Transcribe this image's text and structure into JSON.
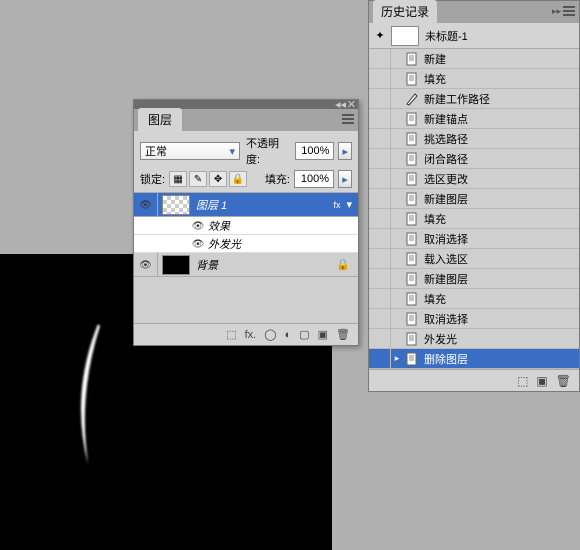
{
  "layers_panel": {
    "title": "图层",
    "blend_mode": "正常",
    "opacity_label": "不透明度:",
    "opacity_value": "100%",
    "lock_label": "锁定:",
    "fill_label": "填充:",
    "fill_value": "100%",
    "layers": [
      {
        "name": "图层 1",
        "fx": "fx",
        "selected": true,
        "thumb": "checker"
      },
      {
        "name": "效果",
        "sub": true
      },
      {
        "name": "外发光",
        "sub": true
      },
      {
        "name": "背景",
        "lock": true,
        "thumb": "black"
      }
    ],
    "footer_icons": [
      "link",
      "fx.",
      "mask",
      "adj",
      "group",
      "new",
      "trash"
    ]
  },
  "history_panel": {
    "title": "历史记录",
    "snapshot": "未标题-1",
    "items": [
      {
        "icon": "doc",
        "text": "新建"
      },
      {
        "icon": "doc",
        "text": "填充"
      },
      {
        "icon": "pen",
        "text": "新建工作路径"
      },
      {
        "icon": "doc",
        "text": "新建锚点"
      },
      {
        "icon": "doc",
        "text": "挑选路径"
      },
      {
        "icon": "doc",
        "text": "闭合路径"
      },
      {
        "icon": "doc",
        "text": "选区更改"
      },
      {
        "icon": "doc",
        "text": "新建图层"
      },
      {
        "icon": "doc",
        "text": "填充"
      },
      {
        "icon": "doc",
        "text": "取消选择"
      },
      {
        "icon": "doc",
        "text": "载入选区"
      },
      {
        "icon": "doc",
        "text": "新建图层"
      },
      {
        "icon": "doc",
        "text": "填充"
      },
      {
        "icon": "doc",
        "text": "取消选择"
      },
      {
        "icon": "doc",
        "text": "外发光"
      },
      {
        "icon": "doc",
        "text": "删除图层",
        "selected": true,
        "caret": true
      }
    ]
  }
}
